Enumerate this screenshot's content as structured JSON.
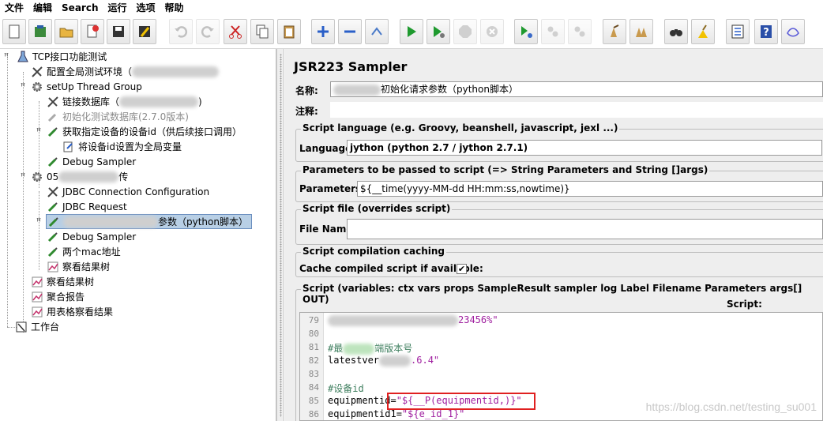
{
  "menu": [
    "文件",
    "编辑",
    "Search",
    "运行",
    "选项",
    "帮助"
  ],
  "tree": {
    "root": "TCP接口功能测试",
    "config_env": "配置全局测试环境（",
    "setup_group": "setUp Thread Group",
    "link_db": "链接数据库（",
    "link_db_tail": ")",
    "init_db": "初始化测试数据库(2.7.0版本)",
    "get_device": "获取指定设备的设备id（供后续接口调用）",
    "set_global": "将设备id设置为全局变量",
    "debug1": "Debug Sampler",
    "group05_prefix": "05",
    "group05_suffix": "传",
    "jdbc_config": "JDBC Connection Configuration",
    "jdbc_request": "JDBC Request",
    "selected_suffix": "参数（python脚本）",
    "debug2": "Debug Sampler",
    "two_mac": "两个mac地址",
    "view_results_inner": "察看结果树",
    "view_results": "察看结果树",
    "aggregate": "聚合报告",
    "table_view": "用表格察看结果",
    "workbench": "工作台"
  },
  "panel": {
    "title": "JSR223 Sampler",
    "name_label": "名称:",
    "name_value": "初始化请求参数（python脚本）",
    "comment_label": "注释:",
    "lang_group": "Script language (e.g. Groovy, beanshell, javascript, jexl ...)",
    "lang_label": "Language:",
    "lang_value": "jython     (python 2.7 / jython 2.7.1)",
    "params_group": "Parameters to be passed to script (=> String Parameters and String []args)",
    "params_label": "Parameters:",
    "params_value": "${__time(yyyy-MM-dd HH:mm:ss,nowtime)}",
    "file_group": "Script file (overrides script)",
    "file_label": "File Name:",
    "cache_group": "Script compilation caching",
    "cache_label": "Cache compiled script if available:",
    "cache_checked": "✔",
    "script_group": "Script (variables: ctx vars props SampleResult sampler log Label Filename Parameters args[] OUT)",
    "script_label": "Script:"
  },
  "code": {
    "l79": "79",
    "c79": "23456%\"",
    "l80": "80",
    "l81": "81",
    "c81a": "#最",
    "c81b": "端版本号",
    "l82": "82",
    "c82a": "latestver",
    "c82b": ".6.4\"",
    "l83": "83",
    "l84": "84",
    "c84": "#设备id",
    "l85": "85",
    "c85a": "equipmentid=",
    "c85b": "\"${__P(equipmentid,)}\"",
    "l86": "86",
    "c86a": "equipmentid1=",
    "c86b": "\"${e_id_1}\""
  },
  "watermark": "https://blog.csdn.net/testing_su001"
}
